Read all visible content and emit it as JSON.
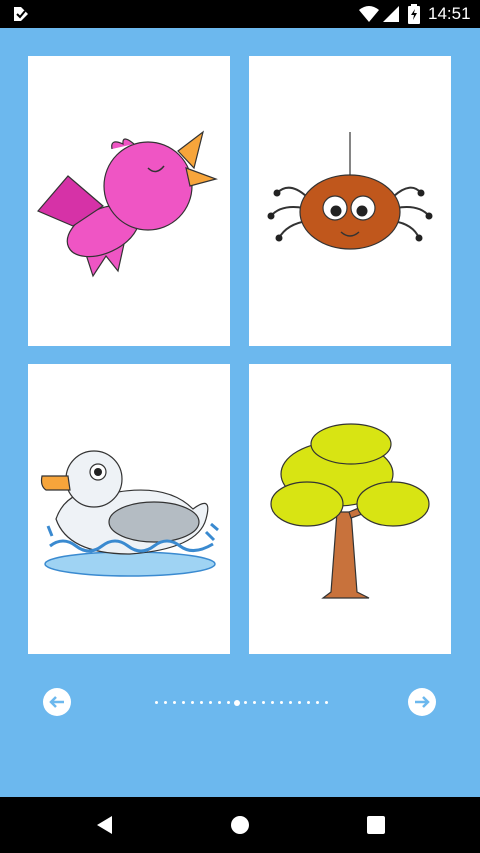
{
  "status_bar": {
    "time": "14:51",
    "icons": [
      "app-notification-icon",
      "wifi-icon",
      "signal-icon",
      "battery-charging-icon"
    ]
  },
  "gallery": {
    "cards": [
      {
        "name": "bird",
        "icon": "bird-icon"
      },
      {
        "name": "spider",
        "icon": "spider-icon"
      },
      {
        "name": "duck",
        "icon": "duck-icon"
      },
      {
        "name": "tree",
        "icon": "tree-icon"
      }
    ],
    "pagination": {
      "total": 20,
      "current": 10
    }
  },
  "colors": {
    "background": "#6cb8ee",
    "bird": "#ef55c4",
    "beak": "#f7a53b",
    "spider": "#c0571c",
    "tree_foliage": "#d8e413",
    "trunk": "#c8723c",
    "water": "#3a8ad0"
  },
  "nav_bar": {
    "buttons": [
      "back",
      "home",
      "recents"
    ]
  }
}
